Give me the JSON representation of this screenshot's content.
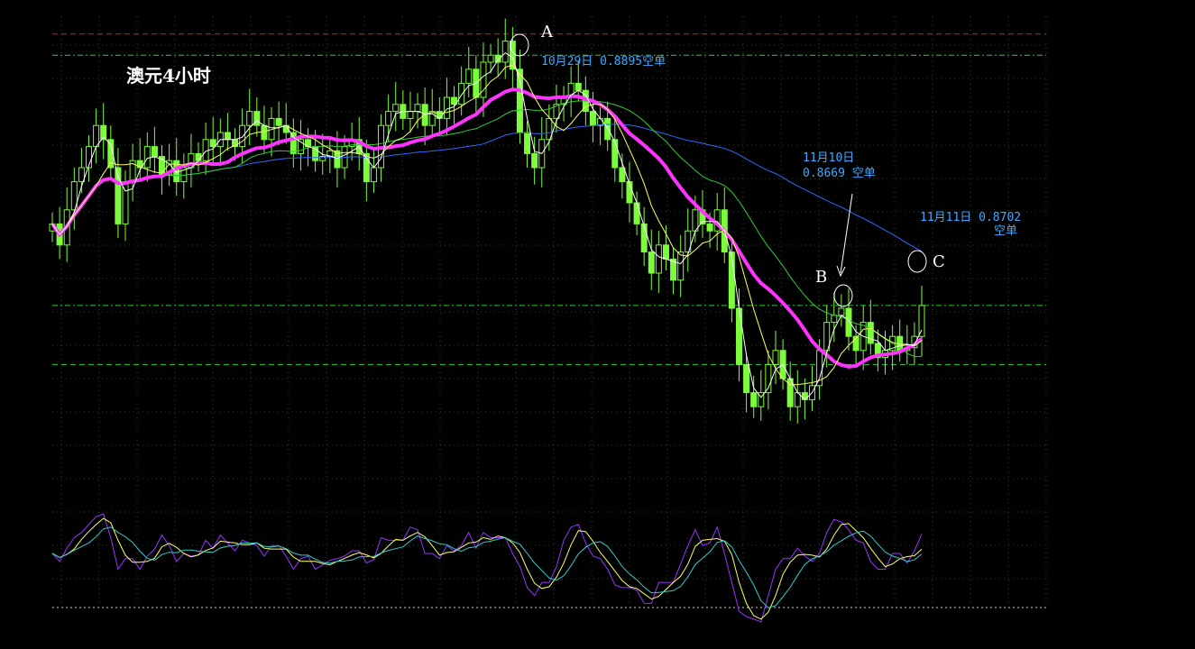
{
  "chart_data": [
    {
      "type": "candlestick",
      "title": "澳元4小时",
      "colors": {
        "background": "#000000",
        "grid": "#1f4a1f",
        "candle": "#7cfc3a",
        "ma_short": "#ffffff",
        "ma_mid": "#ffff66",
        "ma_green": "#33cc33",
        "ma_thick": "#ff33ff",
        "ma_long": "#3366ff",
        "resistance": "#cc2222",
        "level_line": "#33cc33"
      },
      "price_levels": [
        {
          "value": 0.8895,
          "style": "red-dashed"
        },
        {
          "value": 0.888,
          "style": "green-dashdot"
        },
        {
          "value": 0.8702,
          "style": "green-dashdot"
        },
        {
          "value": 0.866,
          "style": "green-dashed"
        }
      ],
      "annotations": [
        {
          "id": "A",
          "label": "A",
          "note_lines": [
            "10月29日 0.8895空单"
          ]
        },
        {
          "id": "B",
          "label": "B",
          "note_lines": [
            "11月10日",
            "0.8669 空单"
          ]
        },
        {
          "id": "C",
          "label": "C",
          "note_lines": [
            "11月11日 0.8702",
            "空单"
          ]
        }
      ],
      "close_series": [
        0.876,
        0.8745,
        0.877,
        0.879,
        0.88,
        0.8815,
        0.883,
        0.882,
        0.88,
        0.876,
        0.879,
        0.8805,
        0.88,
        0.8815,
        0.8808,
        0.8795,
        0.8805,
        0.879,
        0.88,
        0.881,
        0.8805,
        0.882,
        0.8815,
        0.8825,
        0.882,
        0.8815,
        0.883,
        0.884,
        0.883,
        0.882,
        0.8835,
        0.883,
        0.8825,
        0.881,
        0.882,
        0.8815,
        0.8805,
        0.8808,
        0.8812,
        0.88,
        0.8815,
        0.882,
        0.881,
        0.879,
        0.88,
        0.883,
        0.884,
        0.8845,
        0.8835,
        0.884,
        0.8845,
        0.883,
        0.884,
        0.8835,
        0.885,
        0.8845,
        0.886,
        0.887,
        0.885,
        0.8875,
        0.888,
        0.8875,
        0.889,
        0.887,
        0.8825,
        0.881,
        0.88,
        0.882,
        0.8835,
        0.8845,
        0.885,
        0.886,
        0.8855,
        0.884,
        0.883,
        0.8835,
        0.882,
        0.88,
        0.879,
        0.8775,
        0.876,
        0.874,
        0.8725,
        0.8745,
        0.8735,
        0.872,
        0.874,
        0.8755,
        0.877,
        0.876,
        0.8755,
        0.877,
        0.874,
        0.87,
        0.866,
        0.864,
        0.863,
        0.864,
        0.866,
        0.867,
        0.865,
        0.863,
        0.864,
        0.8635,
        0.8645,
        0.867,
        0.869,
        0.8695,
        0.87,
        0.868,
        0.867,
        0.869,
        0.8675,
        0.8665,
        0.867,
        0.868,
        0.867,
        0.8672,
        0.868,
        0.8702
      ],
      "oscillator": {
        "range": [
          0,
          100
        ]
      }
    }
  ]
}
